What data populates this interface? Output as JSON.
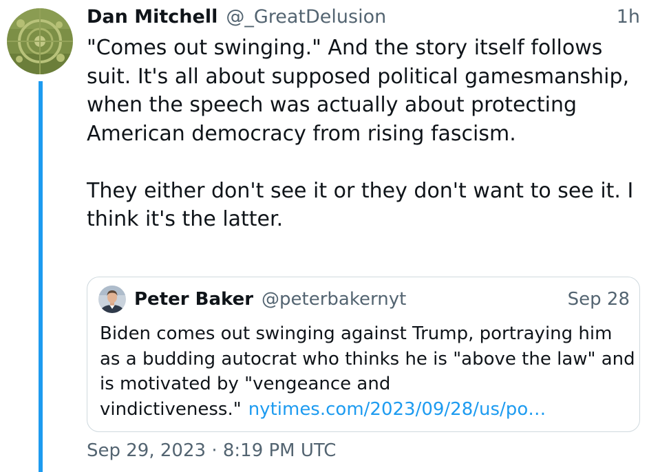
{
  "tweet": {
    "author_name": "Dan Mitchell",
    "author_handle": "@_GreatDelusion",
    "relative_time": "1h",
    "paragraphs": [
      "\"Comes out swinging.\" And the story itself follows suit. It's all about supposed political gamesmanship, when the speech was actually about protecting American democracy from rising fascism.",
      "They either don't see it or they don't want to see it. I think it's the latter."
    ],
    "timestamp": "Sep 29, 2023 · 8:19 PM UTC"
  },
  "quote": {
    "author_name": "Peter Baker",
    "author_handle": "@peterbakernyt",
    "date": "Sep 28",
    "text": "Biden comes out swinging against Trump, portraying him as a budding autocrat who thinks he is \"above the law\" and is motivated by \"vengeance and vindictiveness.\"",
    "link_text": "nytimes.com/2023/09/28/us/po…"
  },
  "colors": {
    "thread_line": "#1d9bf0",
    "link": "#1d9bf0",
    "secondary_text": "#536471",
    "border": "#cfd9de"
  }
}
